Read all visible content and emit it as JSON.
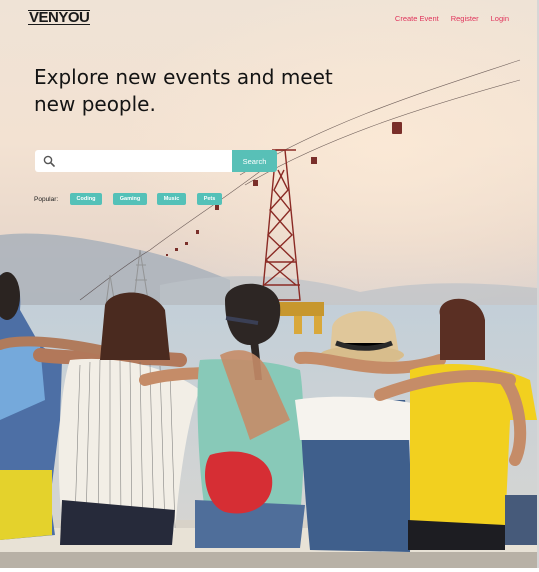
{
  "brand": {
    "logo": "VENYOU"
  },
  "nav": {
    "items": [
      "Create Event",
      "Register",
      "Login"
    ]
  },
  "hero": {
    "title": "Explore new events and meet new people."
  },
  "search": {
    "placeholder": "",
    "value": "",
    "button_label": "Search"
  },
  "popular": {
    "label": "Popular:",
    "tags": [
      "Coding",
      "Gaming",
      "Music",
      "Pets"
    ]
  },
  "colors": {
    "accent": "#58c0b7",
    "nav_link": "#e0335b",
    "text": "#141414"
  },
  "icons": {
    "search": "magnifier-icon"
  }
}
